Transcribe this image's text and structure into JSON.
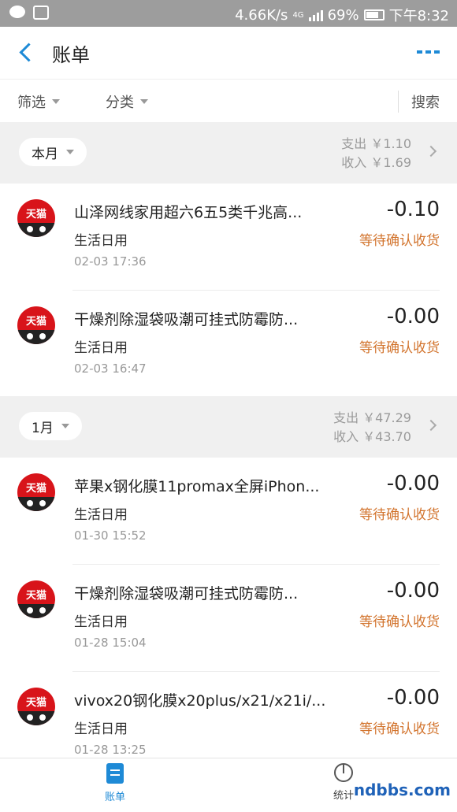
{
  "status_bar": {
    "speed": "4.66K/s",
    "network": "4G",
    "battery": "69%",
    "time": "下午8:32"
  },
  "header": {
    "title": "账单"
  },
  "filter_bar": {
    "filter_label": "筛选",
    "category_label": "分类",
    "search_label": "搜索"
  },
  "months": [
    {
      "label": "本月",
      "expense": "支出 ￥1.10",
      "income": "收入 ￥1.69"
    },
    {
      "label": "1月",
      "expense": "支出 ￥47.29",
      "income": "收入 ￥43.70"
    }
  ],
  "bills": [
    {
      "logo_text": "天猫",
      "title": "山泽网线家用超六6五5类千兆高...",
      "category": "生活日用",
      "time": "02-03  17:36",
      "amount": "-0.10",
      "status": "等待确认收货"
    },
    {
      "logo_text": "天猫",
      "title": "干燥剂除湿袋吸潮可挂式防霉防...",
      "category": "生活日用",
      "time": "02-03  16:47",
      "amount": "-0.00",
      "status": "等待确认收货"
    },
    {
      "logo_text": "天猫",
      "title": "苹果x钢化膜11promax全屏iPhon...",
      "category": "生活日用",
      "time": "01-30  15:52",
      "amount": "-0.00",
      "status": "等待确认收货"
    },
    {
      "logo_text": "天猫",
      "title": "干燥剂除湿袋吸潮可挂式防霉防...",
      "category": "生活日用",
      "time": "01-28  15:04",
      "amount": "-0.00",
      "status": "等待确认收货"
    },
    {
      "logo_text": "天猫",
      "title": "vivox20钢化膜x20plus/x21/x21i/...",
      "category": "生活日用",
      "time": "01-28  13:25",
      "amount": "-0.00",
      "status": "等待确认收货"
    }
  ],
  "bottom_nav": {
    "bill_label": "账单",
    "stats_label": "统计",
    "watermark": "ndbbs.com"
  },
  "colors": {
    "accent": "#1e8ad6",
    "status": "#d2732c",
    "tmall": "#d8141a"
  }
}
